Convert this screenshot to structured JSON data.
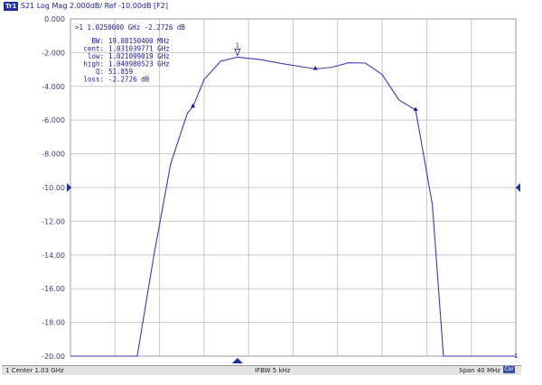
{
  "header": {
    "trace_tag": "Tr1",
    "trace_info": "S21 Log Mag 2.000dB/ Ref -10.00dB [F2]"
  },
  "marker_readout": {
    "marker_line": ">1  1.0250000 GHz -2.2726 dB",
    "stats": [
      {
        "label": "BW:",
        "value": "19.88150400 MHz"
      },
      {
        "label": "cent:",
        "value": "1.031039771 GHz"
      },
      {
        "label": "low:",
        "value": "1.021099019 GHz"
      },
      {
        "label": "high:",
        "value": "1.040980523 GHz"
      },
      {
        "label": "Q:",
        "value": "51.859"
      },
      {
        "label": "loss:",
        "value": "-2.2726 dB"
      }
    ]
  },
  "status_bar": {
    "center": "1  Center 1.03 GHz",
    "ifbw": "IFBW 5 kHz",
    "span": "Span 40 MHz",
    "cor": "Cor"
  },
  "colors": {
    "trace": "#3a3ab4",
    "grid": "#c8c8c8",
    "marker": "#1a1a8c",
    "ref_arrow": "#1f2f9f",
    "tick_text": "#3a3a7a"
  },
  "chart_data": {
    "type": "line",
    "title": "",
    "xlabel": "",
    "ylabel": "",
    "x_unit": "GHz",
    "xlim": [
      1.01,
      1.05
    ],
    "ylim": [
      -20.0,
      0.0
    ],
    "y_ticks": [
      "0.000",
      "-2.000",
      "-4.000",
      "-6.000",
      "-8.000",
      "-10.00",
      "-12.00",
      "-14.00",
      "-16.00",
      "-18.00",
      "-20.00"
    ],
    "reference_level": -10.0,
    "grid": true,
    "series": [
      {
        "x": [
          1.01,
          1.016,
          1.0175,
          1.019,
          1.0205,
          1.021,
          1.022,
          1.0235,
          1.025,
          1.027,
          1.029,
          1.031,
          1.032,
          1.0335,
          1.035,
          1.0365,
          1.038,
          1.0395,
          1.041,
          1.0425,
          1.0435,
          1.045,
          1.05
        ],
        "y": [
          -20.0,
          -20.0,
          -14.0,
          -8.6,
          -5.6,
          -5.2,
          -3.6,
          -2.5,
          -2.27,
          -2.4,
          -2.65,
          -2.86,
          -2.97,
          -2.86,
          -2.6,
          -2.62,
          -3.3,
          -4.8,
          -5.4,
          -11.0,
          -20.0,
          -20.0,
          -20.0
        ]
      }
    ],
    "markers": [
      {
        "id": "1",
        "x": 1.025,
        "y": -2.27,
        "active": true
      },
      {
        "x": 1.021,
        "y": -5.2
      },
      {
        "x": 1.032,
        "y": -2.97
      },
      {
        "x": 1.041,
        "y": -5.4
      }
    ]
  }
}
